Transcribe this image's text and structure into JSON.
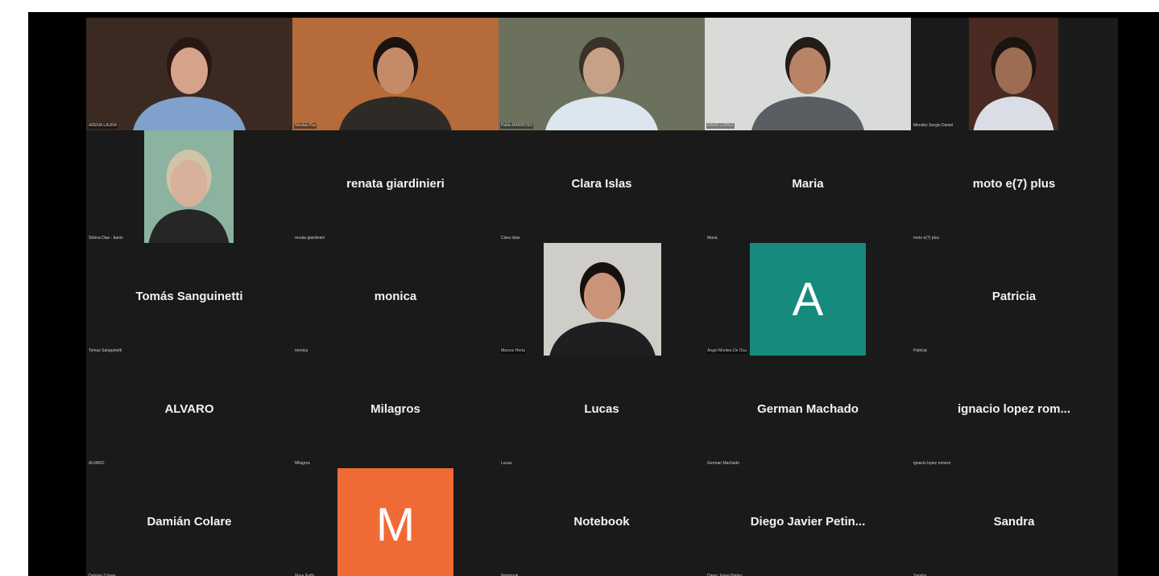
{
  "participants": [
    {
      "display": "",
      "label": "ARENA LAURA",
      "kind": "video",
      "palette": {
        "bg": "#3a2a22",
        "shirt": "#7fa1cc",
        "skin": "#d7a28a",
        "hair": "#2a1612"
      }
    },
    {
      "display": "",
      "label": "Nicolas Paz",
      "kind": "video",
      "palette": {
        "bg": "#b56b3a",
        "shirt": "#2e2a26",
        "skin": "#c58b68",
        "hair": "#1c130e"
      }
    },
    {
      "display": "",
      "label": "Pablo BARROSO",
      "kind": "video",
      "palette": {
        "bg": "#6c715e",
        "shirt": "#dce6ef",
        "skin": "#c7a088",
        "hair": "#3a3128"
      }
    },
    {
      "display": "",
      "label": "DAVID LOPEZ",
      "kind": "video",
      "palette": {
        "bg": "#d9dbd8",
        "shirt": "#5a5e63",
        "skin": "#b98366",
        "hair": "#231c17"
      }
    },
    {
      "display": "",
      "label": "Mendez Sergio Daniel",
      "kind": "video",
      "palette": {
        "bg": "#4a2a22",
        "shirt": "#d9dde5",
        "skin": "#9c6d52",
        "hair": "#1b1410"
      }
    },
    {
      "display": "",
      "label": "Silvina Diaz - banin",
      "kind": "video",
      "palette": {
        "bg": "#8bb3a0",
        "shirt": "#262626",
        "skin": "#d8b19a",
        "hair": "#cfc3a8"
      }
    },
    {
      "display": "renata giardinieri",
      "label": "renata giardinieri",
      "kind": "name"
    },
    {
      "display": "Clara Islas",
      "label": "Clara Islas",
      "kind": "name"
    },
    {
      "display": "Maria",
      "label": "Maria",
      "kind": "name"
    },
    {
      "display": "moto e(7) plus",
      "label": "moto e(7) plus",
      "kind": "name"
    },
    {
      "display": "Tomás Sanguinetti",
      "label": "Tomas Sanguinetti",
      "kind": "name"
    },
    {
      "display": "monica",
      "label": "monica",
      "kind": "name"
    },
    {
      "display": "",
      "label": "Marcos Heria",
      "kind": "video",
      "palette": {
        "bg": "#cfcdc8",
        "shirt": "#1f1f22",
        "skin": "#c99478",
        "hair": "#17110e"
      }
    },
    {
      "display": "A",
      "label": "Angel Montes De Oca",
      "kind": "avatar",
      "avatar_color": "#168a7c"
    },
    {
      "display": "Patricia",
      "label": "Patricia",
      "kind": "name"
    },
    {
      "display": "ALVARO",
      "label": "ALVARO",
      "kind": "name"
    },
    {
      "display": "Milagros",
      "label": "Milagros",
      "kind": "name"
    },
    {
      "display": "Lucas",
      "label": "Lucas",
      "kind": "name"
    },
    {
      "display": "German Machado",
      "label": "German Machado",
      "kind": "name"
    },
    {
      "display": "ignacio lopez rom...",
      "label": "ignacio lopez romero",
      "kind": "name"
    },
    {
      "display": "Damián Colare",
      "label": "Damian Colare",
      "kind": "name"
    },
    {
      "display": "M",
      "label": "Mara Raffo",
      "kind": "avatar",
      "avatar_color": "#f06a35"
    },
    {
      "display": "Notebook",
      "label": "Notebook",
      "kind": "name"
    },
    {
      "display": "Diego Javier Petin...",
      "label": "Diego Javier Petino",
      "kind": "name"
    },
    {
      "display": "Sandra",
      "label": "Sandra",
      "kind": "name"
    }
  ]
}
